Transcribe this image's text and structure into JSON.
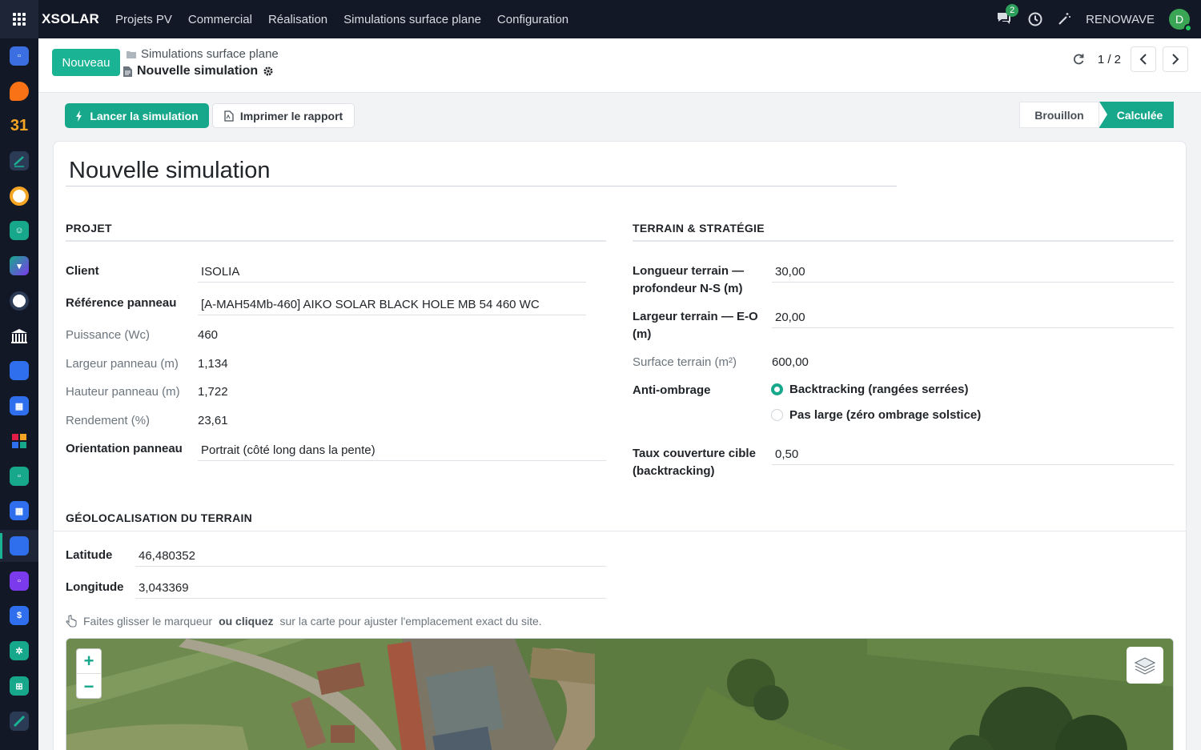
{
  "navbar": {
    "brand": "XSOLAR",
    "menu": [
      "Projets PV",
      "Commercial",
      "Réalisation",
      "Simulations surface plane",
      "Configuration"
    ],
    "chat_count": "2",
    "company": "RENOWAVE",
    "avatar_initial": "D"
  },
  "control_panel": {
    "new_button": "Nouveau",
    "breadcrumb_parent": "Simulations surface plane",
    "breadcrumb_current": "Nouvelle simulation",
    "pager": "1 / 2"
  },
  "actions": {
    "run_label": "Lancer la simulation",
    "print_label": "Imprimer le rapport"
  },
  "status": {
    "draft": "Brouillon",
    "done": "Calculée",
    "current": "Calculée"
  },
  "form": {
    "name": "Nouvelle simulation",
    "project": {
      "title": "PROJET",
      "client_label": "Client",
      "client": "ISOLIA",
      "panel_ref_label": "Référence panneau",
      "panel_ref": "[A-MAH54Mb-460] AIKO SOLAR BLACK HOLE MB 54 460 WC",
      "power_label": "Puissance (Wc)",
      "power": "460",
      "width_label": "Largeur panneau (m)",
      "width": "1,134",
      "height_label": "Hauteur panneau (m)",
      "height": "1,722",
      "efficiency_label": "Rendement (%)",
      "efficiency": "23,61",
      "orientation_label": "Orientation panneau",
      "orientation": "Portrait (côté long dans la pente)"
    },
    "terrain": {
      "title": "TERRAIN & STRATÉGIE",
      "length_label_1": "Longueur terrain —",
      "length_label_2": "profondeur N-S (m)",
      "length": "30,00",
      "width_label_1": "Largeur terrain — E-O",
      "width_label_2": "(m)",
      "width": "20,00",
      "surface_label": "Surface terrain (m²)",
      "surface": "600,00",
      "shading_label": "Anti-ombrage",
      "shading_options": [
        "Backtracking (rangées serrées)",
        "Pas large (zéro ombrage solstice)"
      ],
      "shading_selected": "Backtracking (rangées serrées)",
      "coverage_label_1": "Taux couverture cible",
      "coverage_label_2": "(backtracking)",
      "coverage": "0,50"
    },
    "geo": {
      "title": "GÉOLOCALISATION DU TERRAIN",
      "lat_label": "Latitude",
      "lat": "46,480352",
      "lon_label": "Longitude",
      "lon": "3,043369",
      "hint_pre": "Faites glisser le marqueur",
      "hint_bold": "ou cliquez",
      "hint_post": "sur la carte pour ajuster l'emplacement exact du site."
    },
    "map": {
      "zoom_in": "+",
      "zoom_out": "−"
    }
  },
  "colors": {
    "accent": "#17a88b",
    "navbar": "#121826"
  }
}
